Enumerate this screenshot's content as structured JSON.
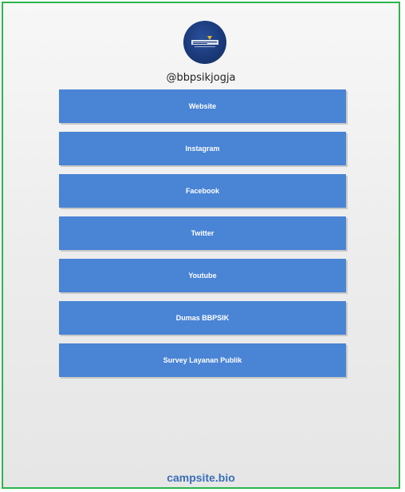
{
  "profile": {
    "handle": "@bbpsikjogja",
    "avatar_icon": "organization-logo-icon"
  },
  "links": [
    {
      "label": "Website"
    },
    {
      "label": "Instagram"
    },
    {
      "label": "Facebook"
    },
    {
      "label": "Twitter"
    },
    {
      "label": "Youtube"
    },
    {
      "label": "Dumas BBPSIK"
    },
    {
      "label": "Survey Layanan Publik"
    }
  ],
  "footer": {
    "brand": "campsite.bio"
  },
  "colors": {
    "button": "#4a84d4",
    "frame_border": "#2bb54b",
    "footer_text": "#3a6fb8",
    "avatar_bg": "#1b3a7a"
  }
}
